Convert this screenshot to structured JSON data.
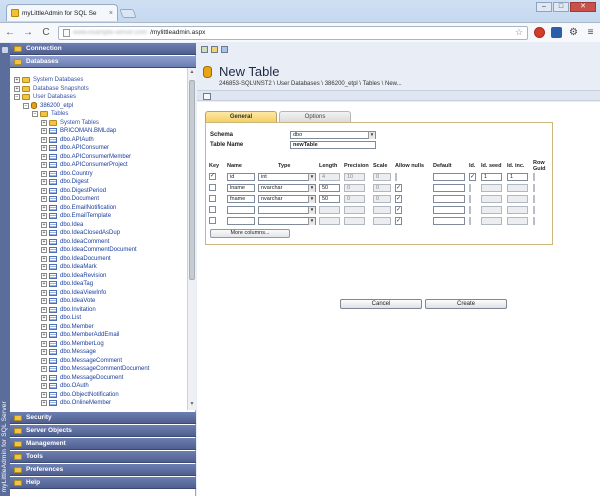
{
  "browser": {
    "tab_title": "myLittleAdmin for SQL Se",
    "tab_close": "×",
    "url_host": "www.example-server.com",
    "url_path": "/mylittleadmin.aspx",
    "back": "←",
    "forward": "→",
    "reload": "C",
    "star": "☆",
    "gear": "⚙",
    "menu": "≡",
    "win_min": "–",
    "win_max": "□",
    "win_close": "✕"
  },
  "sidebar": {
    "vertical_label": "myLittleAdmin for SQL Server",
    "sections_top": [
      {
        "label": "Connection"
      },
      {
        "label": "Databases"
      }
    ],
    "sections_bottom": [
      {
        "label": "Security"
      },
      {
        "label": "Server Objects"
      },
      {
        "label": "Management"
      },
      {
        "label": "Tools"
      },
      {
        "label": "Preferences"
      },
      {
        "label": "Help"
      }
    ],
    "tree": [
      {
        "indent": 0,
        "exp": "+",
        "icon": "folder",
        "label": "System Databases"
      },
      {
        "indent": 0,
        "exp": "+",
        "icon": "folder",
        "label": "Database Snapshots"
      },
      {
        "indent": 0,
        "exp": "−",
        "icon": "folder",
        "label": "User Databases"
      },
      {
        "indent": 1,
        "exp": "−",
        "icon": "db",
        "label": "386200_etpl"
      },
      {
        "indent": 2,
        "exp": "−",
        "icon": "folder",
        "label": "Tables"
      },
      {
        "indent": 3,
        "exp": "+",
        "icon": "folder",
        "label": "System Tables"
      },
      {
        "indent": 3,
        "exp": "+",
        "icon": "table",
        "label": "BRICOMAN.BMLdap"
      },
      {
        "indent": 3,
        "exp": "+",
        "icon": "table",
        "label": "dbo.APIAuth"
      },
      {
        "indent": 3,
        "exp": "+",
        "icon": "table",
        "label": "dbo.APIConsumer"
      },
      {
        "indent": 3,
        "exp": "+",
        "icon": "table",
        "label": "dbo.APIConsumerMember"
      },
      {
        "indent": 3,
        "exp": "+",
        "icon": "table",
        "label": "dbo.APIConsumerProject"
      },
      {
        "indent": 3,
        "exp": "+",
        "icon": "table",
        "label": "dbo.Country"
      },
      {
        "indent": 3,
        "exp": "+",
        "icon": "table",
        "label": "dbo.Digest"
      },
      {
        "indent": 3,
        "exp": "+",
        "icon": "table",
        "label": "dbo.DigestPeriod"
      },
      {
        "indent": 3,
        "exp": "+",
        "icon": "table",
        "label": "dbo.Document"
      },
      {
        "indent": 3,
        "exp": "+",
        "icon": "table",
        "label": "dbo.EmailNotification"
      },
      {
        "indent": 3,
        "exp": "+",
        "icon": "table",
        "label": "dbo.EmailTemplate"
      },
      {
        "indent": 3,
        "exp": "+",
        "icon": "table",
        "label": "dbo.Idea"
      },
      {
        "indent": 3,
        "exp": "+",
        "icon": "table",
        "label": "dbo.IdeaClosedAsDup"
      },
      {
        "indent": 3,
        "exp": "+",
        "icon": "table",
        "label": "dbo.IdeaComment"
      },
      {
        "indent": 3,
        "exp": "+",
        "icon": "table",
        "label": "dbo.IdeaCommentDocument"
      },
      {
        "indent": 3,
        "exp": "+",
        "icon": "table",
        "label": "dbo.IdeaDocument"
      },
      {
        "indent": 3,
        "exp": "+",
        "icon": "table",
        "label": "dbo.IdeaMark"
      },
      {
        "indent": 3,
        "exp": "+",
        "icon": "table",
        "label": "dbo.IdeaRevision"
      },
      {
        "indent": 3,
        "exp": "+",
        "icon": "table",
        "label": "dbo.IdeaTag"
      },
      {
        "indent": 3,
        "exp": "+",
        "icon": "table",
        "label": "dbo.IdeaViewInfo"
      },
      {
        "indent": 3,
        "exp": "+",
        "icon": "table",
        "label": "dbo.IdeaVote"
      },
      {
        "indent": 3,
        "exp": "+",
        "icon": "table",
        "label": "dbo.Invitation"
      },
      {
        "indent": 3,
        "exp": "+",
        "icon": "table",
        "label": "dbo.List"
      },
      {
        "indent": 3,
        "exp": "+",
        "icon": "table",
        "label": "dbo.Member"
      },
      {
        "indent": 3,
        "exp": "+",
        "icon": "table",
        "label": "dbo.MemberAddEmail"
      },
      {
        "indent": 3,
        "exp": "+",
        "icon": "table",
        "label": "dbo.MemberLog"
      },
      {
        "indent": 3,
        "exp": "+",
        "icon": "table",
        "label": "dbo.Message"
      },
      {
        "indent": 3,
        "exp": "+",
        "icon": "table",
        "label": "dbo.MessageComment"
      },
      {
        "indent": 3,
        "exp": "+",
        "icon": "table",
        "label": "dbo.MessageCommentDocument"
      },
      {
        "indent": 3,
        "exp": "+",
        "icon": "table",
        "label": "dbo.MessageDocument"
      },
      {
        "indent": 3,
        "exp": "+",
        "icon": "table",
        "label": "dbo.OAuth"
      },
      {
        "indent": 3,
        "exp": "+",
        "icon": "table",
        "label": "dbo.ObjectNotification"
      },
      {
        "indent": 3,
        "exp": "+",
        "icon": "table",
        "label": "dbo.OnlineMember"
      }
    ]
  },
  "main": {
    "title": "New Table",
    "breadcrumb": "246853-SQL\\INST2 \\ User Databases \\ 386200_etpl \\ Tables \\ New...",
    "tabs": [
      {
        "label": "General",
        "active": true
      },
      {
        "label": "Options",
        "active": false
      }
    ],
    "schema_label": "Schema",
    "schema_value": "dbo",
    "table_name_label": "Table Name",
    "table_name_value": "newTable",
    "columns_header": {
      "key": "Key",
      "name": "Name",
      "type": "Type",
      "length": "Length",
      "precision": "Precision",
      "scale": "Scale",
      "allow_nulls": "Allow nulls",
      "default": "Default",
      "id": "Id.",
      "id_seed": "Id. seed",
      "id_inc": "Id. inc.",
      "row_guid": "Row Guid"
    },
    "rows": [
      {
        "key": "✓",
        "name": "id",
        "type": "int",
        "length": "4",
        "precision": "10",
        "scale": "0",
        "allow_nulls": "",
        "default": "",
        "id": "✓",
        "id_seed": "1",
        "id_inc": "1",
        "row_guid": ""
      },
      {
        "key": "",
        "name": "lname",
        "type": "nvarchar",
        "length": "50",
        "precision": "0",
        "scale": "0",
        "allow_nulls": "✓",
        "default": "",
        "id": "",
        "id_seed": "",
        "id_inc": "",
        "row_guid": ""
      },
      {
        "key": "",
        "name": "fname",
        "type": "nvarchar",
        "length": "50",
        "precision": "0",
        "scale": "0",
        "allow_nulls": "✓",
        "default": "",
        "id": "",
        "id_seed": "",
        "id_inc": "",
        "row_guid": ""
      },
      {
        "key": "",
        "name": "",
        "type": "",
        "length": "",
        "precision": "",
        "scale": "",
        "allow_nulls": "✓",
        "default": "",
        "id": "",
        "id_seed": "",
        "id_inc": "",
        "row_guid": ""
      },
      {
        "key": "",
        "name": "",
        "type": "",
        "length": "",
        "precision": "",
        "scale": "",
        "allow_nulls": "✓",
        "default": "",
        "id": "",
        "id_seed": "",
        "id_inc": "",
        "row_guid": ""
      }
    ],
    "more_columns": "More columns...",
    "cancel": "Cancel",
    "create": "Create"
  }
}
